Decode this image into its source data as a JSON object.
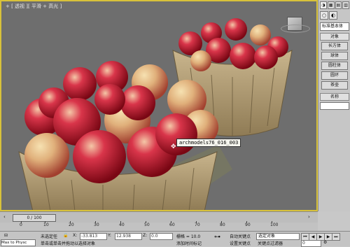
{
  "viewport": {
    "label": "+ [ 透视 ][ 平滑 + 高光 ]",
    "tooltip": "archmodels76_016_003"
  },
  "command_panel": {
    "tabs": [
      "◑",
      "▦",
      "▤",
      "▥"
    ],
    "category_icons": [
      "○",
      "◐"
    ],
    "dropdown": "标准基本体",
    "rollout_object_type": "对象",
    "buttons": [
      "长方体",
      "球体",
      "圆柱体",
      "圆环",
      "茶壶"
    ],
    "rollout_name": "名称"
  },
  "timeline": {
    "slider_label": "0 / 100",
    "ticks": [
      "0",
      "10",
      "20",
      "30",
      "40",
      "50",
      "60",
      "70",
      "80",
      "90",
      "100"
    ]
  },
  "status_bar": {
    "selection_text": "未选定任",
    "x_label": "X:",
    "x_value": "-33.813",
    "y_label": "Y:",
    "y_value": "12.938",
    "z_label": "Z:",
    "z_value": "0.0",
    "grid_text": "栅格 = 10.0",
    "prompt_text": "单击或单击并拖动以选择对象",
    "add_time_tag": "添加时间标记",
    "auto_key": "自动关键点",
    "set_key": "设置关键点",
    "key_filters": "关键点过滤器",
    "selected_combo": "选定对象",
    "frame_value": "0",
    "maxscript_label": "Max to Physc"
  },
  "colors": {
    "viewport_bg": "#6e6e6e",
    "viewport_border": "#d8c23a",
    "apple_red": "#c5182a",
    "basket": "#b7a27a"
  }
}
